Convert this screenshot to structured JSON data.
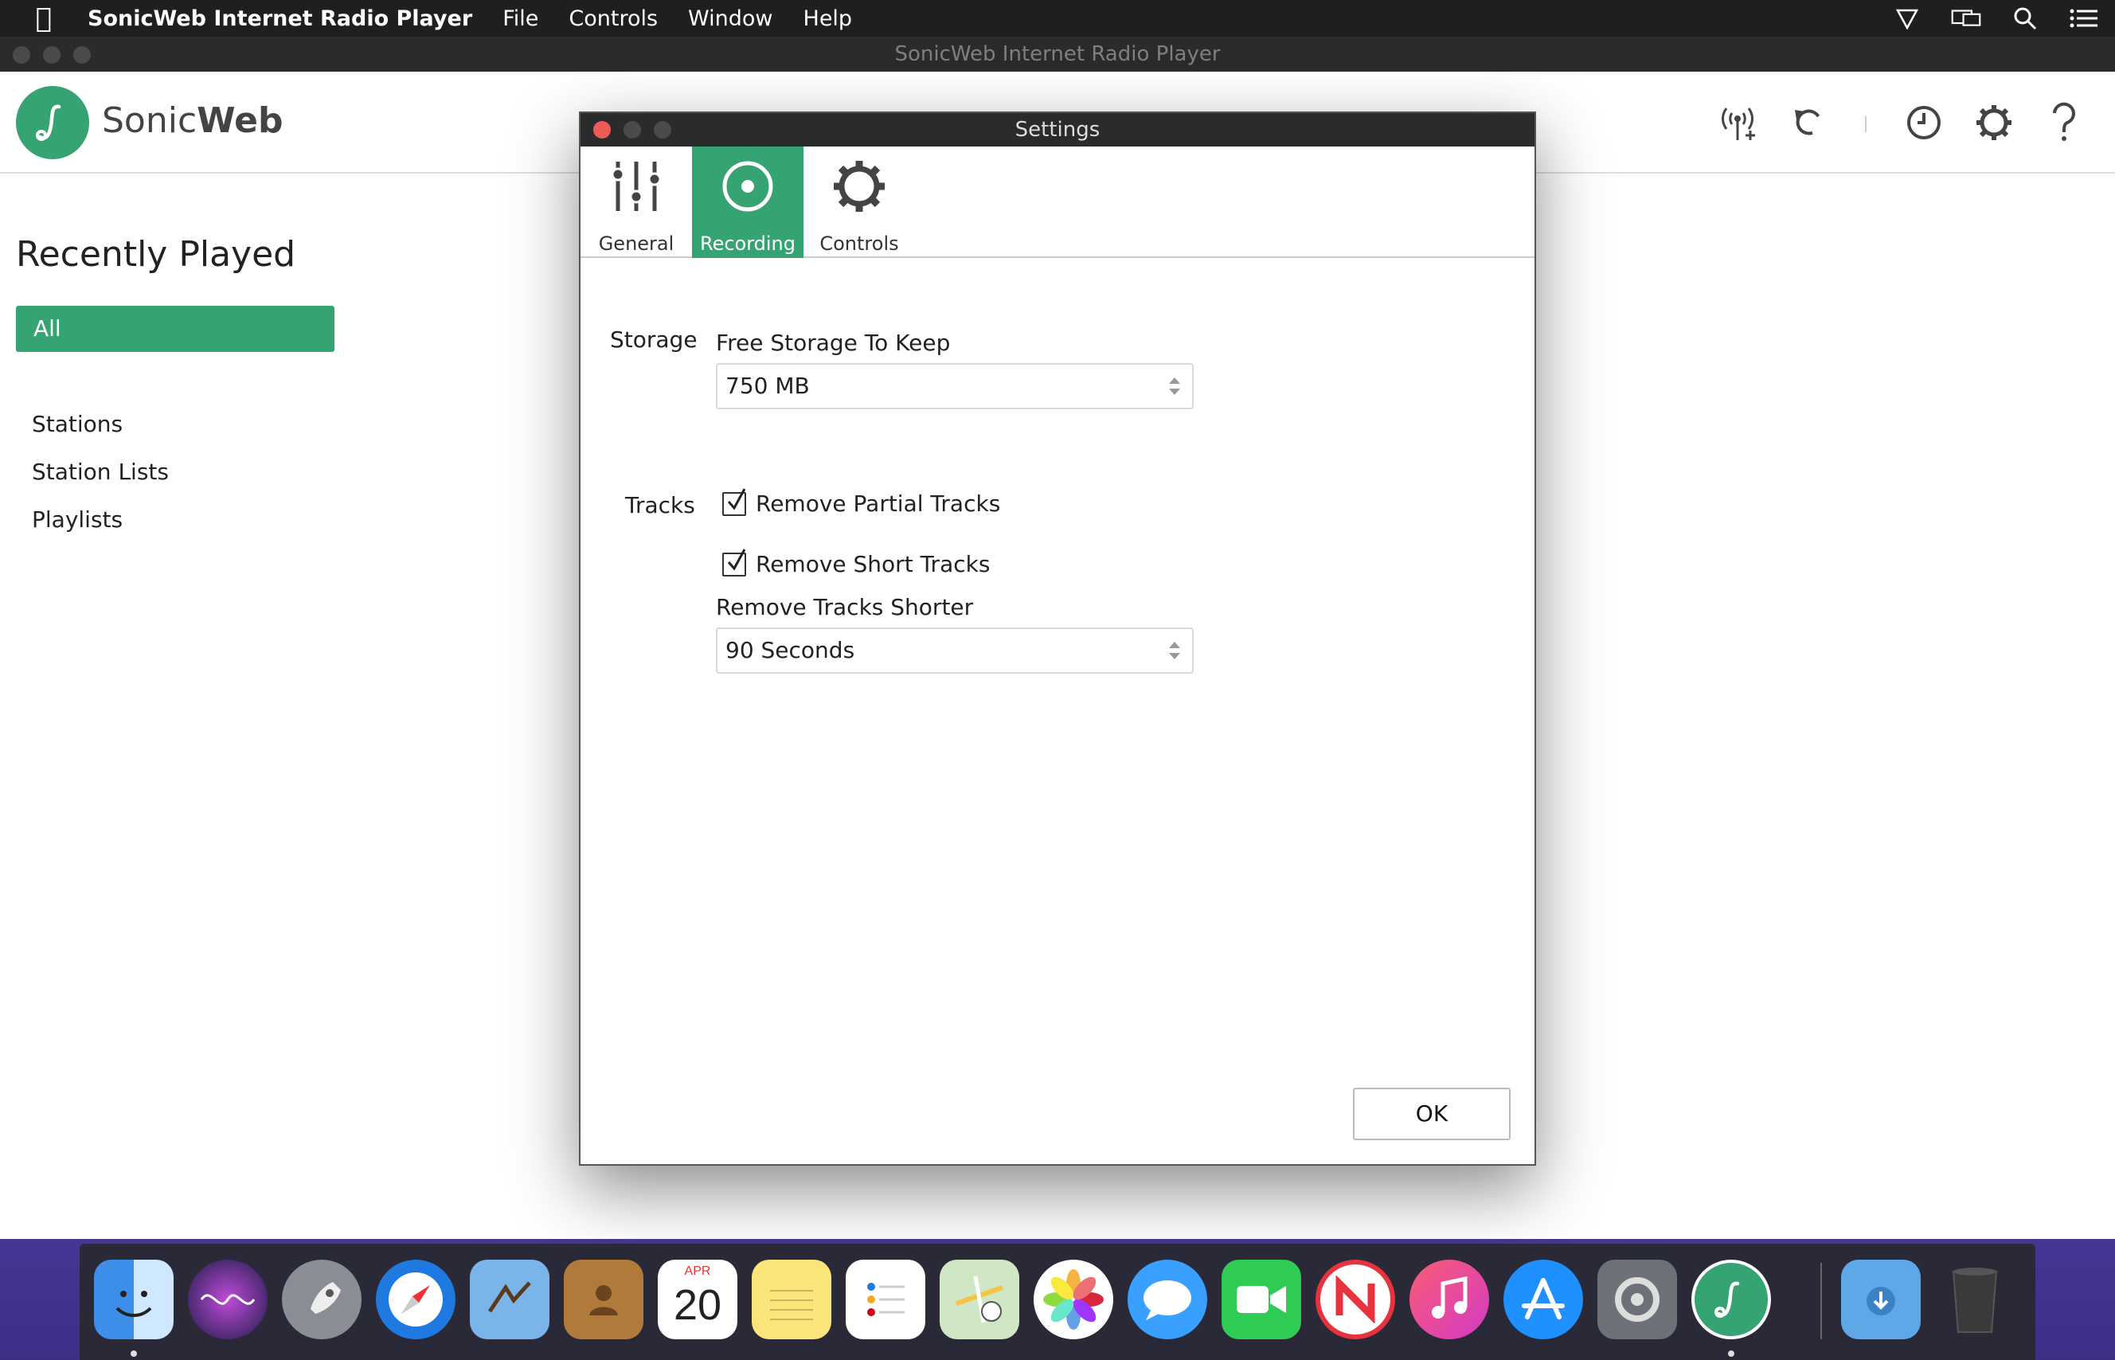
{
  "menubar": {
    "app_name": "SonicWeb Internet Radio Player",
    "items": [
      "File",
      "Controls",
      "Window",
      "Help"
    ],
    "status_icons": [
      "airplay-icon",
      "display-icon",
      "spotlight-icon",
      "notification-list-icon"
    ]
  },
  "window": {
    "title": "SonicWeb Internet Radio Player",
    "brand_light": "Sonic",
    "brand_bold": "Web",
    "toolbar_icons": [
      "add-station-icon",
      "refresh-icon",
      "history-icon",
      "settings-gear-icon",
      "help-icon"
    ]
  },
  "sidebar": {
    "heading": "Recently Played",
    "selected": "All",
    "links": [
      "Stations",
      "Station Lists",
      "Playlists"
    ]
  },
  "settings": {
    "title": "Settings",
    "tabs": [
      {
        "label": "General",
        "icon": "sliders-icon",
        "active": false
      },
      {
        "label": "Recording",
        "icon": "record-icon",
        "active": true
      },
      {
        "label": "Controls",
        "icon": "gear-icon",
        "active": false
      }
    ],
    "storage": {
      "section": "Storage",
      "field_label": "Free Storage To Keep",
      "value": "750 MB"
    },
    "tracks": {
      "section": "Tracks",
      "remove_partial": {
        "label": "Remove Partial Tracks",
        "checked": true
      },
      "remove_short": {
        "label": "Remove Short Tracks",
        "checked": true
      },
      "shorter_label": "Remove Tracks Shorter",
      "shorter_value": "90 Seconds"
    },
    "ok_label": "OK"
  },
  "dock": {
    "calendar_month": "APR",
    "calendar_day": "20",
    "icons": [
      "finder-icon",
      "siri-icon",
      "launchpad-icon",
      "safari-icon",
      "mail-icon",
      "contacts-icon",
      "calendar-icon",
      "notes-icon",
      "reminders-icon",
      "maps-icon",
      "photos-icon",
      "messages-icon",
      "facetime-icon",
      "news-icon",
      "music-icon",
      "app-store-icon",
      "system-preferences-icon",
      "sonicweb-icon",
      "downloads-folder-icon",
      "trash-icon"
    ]
  },
  "colors": {
    "accent": "#35a372",
    "close": "#ec5b56"
  }
}
